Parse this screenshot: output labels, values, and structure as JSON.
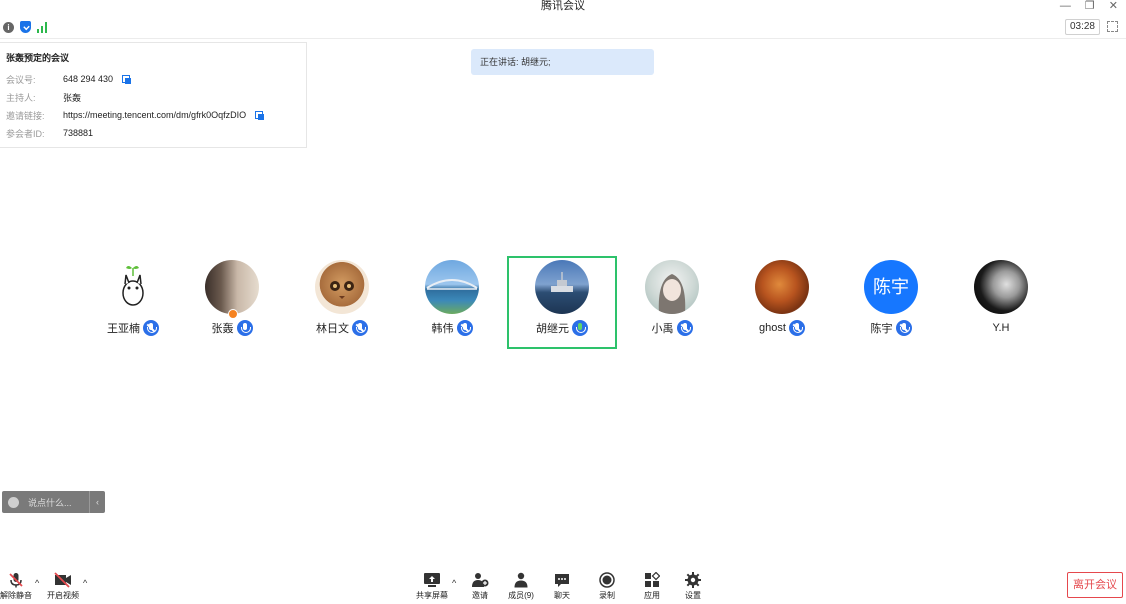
{
  "window": {
    "title": "腾讯会议",
    "controls": [
      "—",
      "❐",
      "✕"
    ]
  },
  "status": {
    "timer": "03:28"
  },
  "meeting_info": {
    "title": "张轰预定的会议",
    "rows": [
      {
        "label": "会议号:",
        "value": "648 294 430",
        "copy": true
      },
      {
        "label": "主持人:",
        "value": "张轰",
        "copy": false
      },
      {
        "label": "邀请链接:",
        "value": "https://meeting.tencent.com/dm/gfrk0OqfzDIO",
        "copy": true
      },
      {
        "label": "参会者ID:",
        "value": "738881",
        "copy": false
      }
    ]
  },
  "speaking_banner": "正在讲话: 胡继元;",
  "participants": [
    {
      "name": "王亚楠",
      "avatar": "totoro",
      "mic": "muted"
    },
    {
      "name": "张轰",
      "avatar": "room",
      "mic": "on",
      "host": true
    },
    {
      "name": "林日文",
      "avatar": "cat",
      "mic": "muted"
    },
    {
      "name": "韩伟",
      "avatar": "bridge",
      "mic": "muted"
    },
    {
      "name": "胡继元",
      "avatar": "ship",
      "mic": "speaking",
      "active": true
    },
    {
      "name": "小禹",
      "avatar": "girl",
      "mic": "muted"
    },
    {
      "name": "ghost",
      "avatar": "tree",
      "mic": "muted"
    },
    {
      "name": "陈宇",
      "avatar": "text",
      "avatar_text": "陈宇",
      "mic": "muted"
    },
    {
      "name": "Y.H",
      "avatar": "bw",
      "mic": "none"
    }
  ],
  "chat": {
    "placeholder": "说点什么...",
    "collapse": "‹"
  },
  "toolbar": {
    "unmute": "解除静音",
    "video": "开启视频",
    "share": "共享屏幕",
    "invite": "邀请",
    "members": "成员(9)",
    "chat": "聊天",
    "record": "录制",
    "apps": "应用",
    "settings": "设置",
    "leave": "离开会议"
  },
  "colors": {
    "accent": "#1677ff",
    "active_border": "#2dc26b",
    "leave": "#e5484d",
    "banner_bg": "#dbe9fb"
  }
}
